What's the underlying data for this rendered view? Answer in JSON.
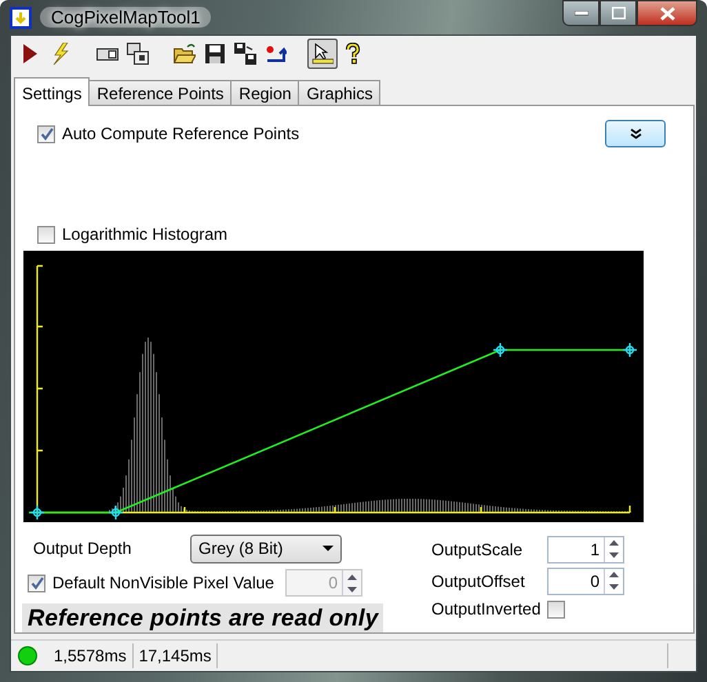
{
  "window": {
    "title": "CogPixelMapTool1"
  },
  "toolbar": [
    {
      "kind": "run",
      "pressed": false
    },
    {
      "kind": "flash",
      "pressed": false
    },
    {
      "kind": "window",
      "pressed": false
    },
    {
      "kind": "window-copy",
      "pressed": false
    },
    {
      "kind": "open",
      "pressed": false
    },
    {
      "kind": "save",
      "pressed": false
    },
    {
      "kind": "save-as",
      "pressed": false
    },
    {
      "kind": "import",
      "pressed": false
    },
    {
      "kind": "pointer",
      "pressed": true
    },
    {
      "kind": "help",
      "pressed": false
    }
  ],
  "tabs": [
    {
      "label": "Settings",
      "selected": true
    },
    {
      "label": "Reference Points",
      "selected": false
    },
    {
      "label": "Region",
      "selected": false
    },
    {
      "label": "Graphics",
      "selected": false
    }
  ],
  "settings": {
    "auto_compute": {
      "label": "Auto Compute Reference Points",
      "checked": true
    },
    "log_histogram": {
      "label": "Logarithmic Histogram",
      "checked": false
    },
    "output_depth": {
      "label": "Output Depth",
      "value": "Grey (8 Bit)"
    },
    "default_nonvisible": {
      "label": "Default NonVisible Pixel Value",
      "checked": true,
      "value": "0",
      "disabled": true
    },
    "output_scale": {
      "label": "OutputScale",
      "value": "1"
    },
    "output_offset": {
      "label": "OutputOffset",
      "value": "0"
    },
    "output_inverted": {
      "label": "OutputInverted",
      "checked": false
    }
  },
  "banner": "Reference points are read only",
  "status_bar": {
    "times": [
      "1,5578ms",
      "17,145ms"
    ]
  }
}
